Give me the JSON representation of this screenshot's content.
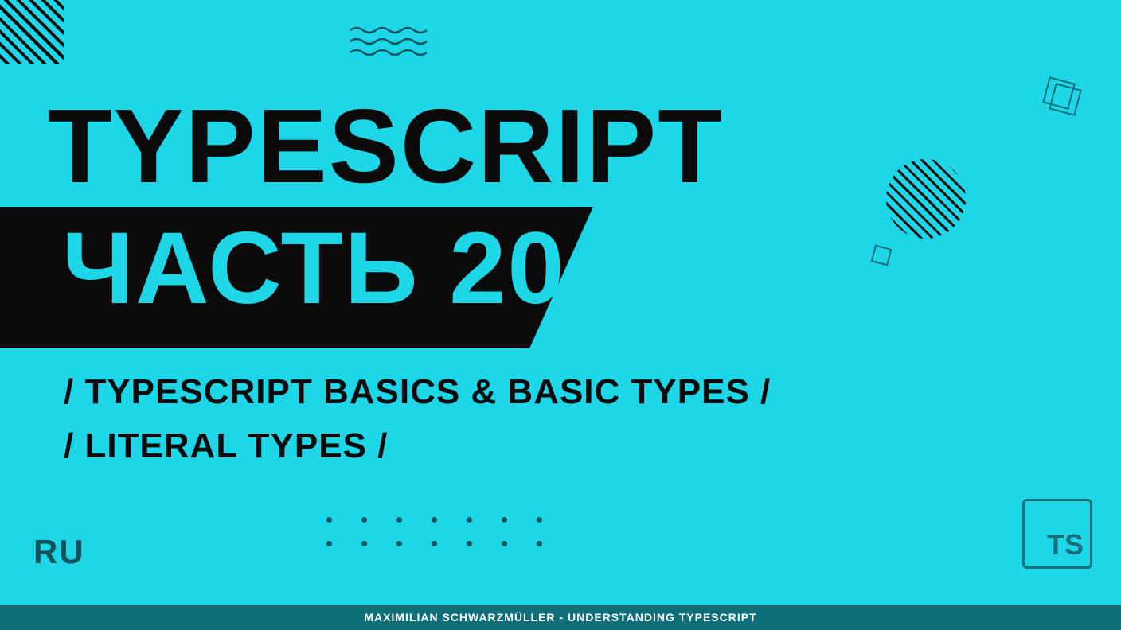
{
  "title": "TYPESCRIPT",
  "part": "ЧАСТЬ 20",
  "subtitle1": "/ TYPESCRIPT BASICS & BASIC TYPES /",
  "subtitle2": "/ LITERAL TYPES /",
  "lang": "RU",
  "logo": "TS",
  "footer": "MAXIMILIAN SCHWARZMÜLLER - UNDERSTANDING TYPESCRIPT"
}
